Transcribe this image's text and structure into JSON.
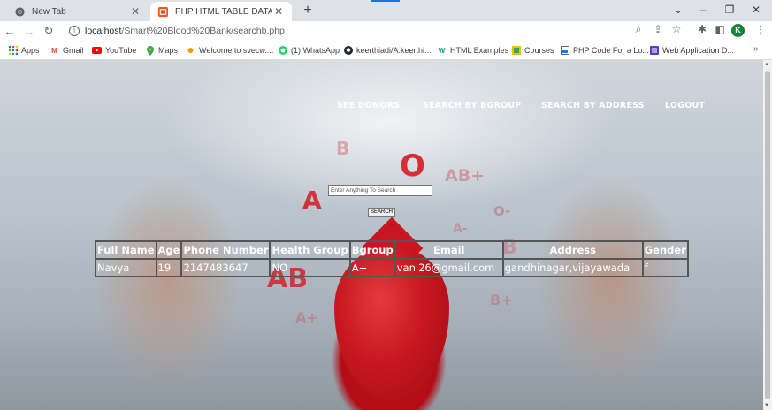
{
  "browser": {
    "tabs": [
      {
        "title": "New Tab",
        "active": false
      },
      {
        "title": "PHP HTML TABLE DATA SEARCH",
        "active": true
      }
    ],
    "new_tab": "+",
    "url_host": "localhost",
    "url_path": "/Smart%20Blood%20Bank/searchb.php",
    "profile_initial": "K",
    "bookmarks": [
      {
        "label": "Apps",
        "icon": "apps-grid-icon"
      },
      {
        "label": "Gmail",
        "icon": "gmail-icon"
      },
      {
        "label": "YouTube",
        "icon": "youtube-icon"
      },
      {
        "label": "Maps",
        "icon": "maps-icon"
      },
      {
        "label": "Welcome to svecw....",
        "icon": "site-icon"
      },
      {
        "label": "(1) WhatsApp",
        "icon": "whatsapp-icon"
      },
      {
        "label": "keerthiadi/A.keerthi...",
        "icon": "github-icon"
      },
      {
        "label": "HTML Examples",
        "icon": "w3schools-icon"
      },
      {
        "label": "Courses",
        "icon": "courses-icon"
      },
      {
        "label": "PHP Code For a Lo...",
        "icon": "site-icon"
      },
      {
        "label": "Web Application D...",
        "icon": "site-icon"
      }
    ],
    "more_bookmarks": "»"
  },
  "page": {
    "nav": {
      "see_donors": "SEE DONORS",
      "search_by_bgroup": "SEARCH BY BGROUP",
      "search_by_address": "SEARCH BY ADDRESS",
      "logout": "LOGOUT"
    },
    "search": {
      "placeholder": "Enter Anything To Search",
      "value": "",
      "button_label": "SEARCH"
    },
    "background_letters": [
      "B",
      "O",
      "AB+",
      "A",
      "O-",
      "A-",
      "AB",
      "B",
      "A+",
      "B+"
    ],
    "table": {
      "headers": [
        "Full Name",
        "Age",
        "Phone Number",
        "Health Group",
        "Bgroup",
        "Email",
        "Address",
        "Gender"
      ],
      "rows": [
        [
          "Navya",
          "19",
          "2147483647",
          "NO",
          "A+",
          "vani26@gmail.com",
          "gandhinagar,vijayawada",
          "f"
        ]
      ]
    }
  },
  "colors": {
    "nav_text": "#ffffff",
    "table_text": "#ffffff",
    "blood_red": "#c81720",
    "profile": "#188038",
    "accent": "#1a73e8"
  }
}
